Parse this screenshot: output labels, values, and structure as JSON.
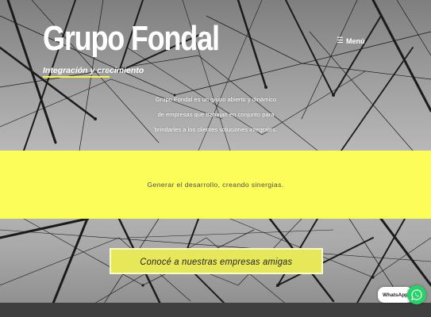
{
  "header": {
    "site_title": "Grupo Fondal",
    "tagline": "Integración y crecimiento",
    "menu_label": "Menú",
    "menu_icon": "hamburger-icon"
  },
  "hero": {
    "intro_text": "Grupo Fondal es un grupo abierto y dinámico de empresas que trabajan en conjunto para brindarles a los clientes soluciones integrales."
  },
  "band": {
    "text": "Generar el desarrollo, creando sinergias.",
    "background_color": "#fdfd59"
  },
  "cta": {
    "label": "Conocé a nuestras empresas amigas",
    "background_color": "#e7e75a"
  },
  "whatsapp": {
    "label": "WhatsApp",
    "icon": "whatsapp-icon",
    "color": "#25d366"
  }
}
